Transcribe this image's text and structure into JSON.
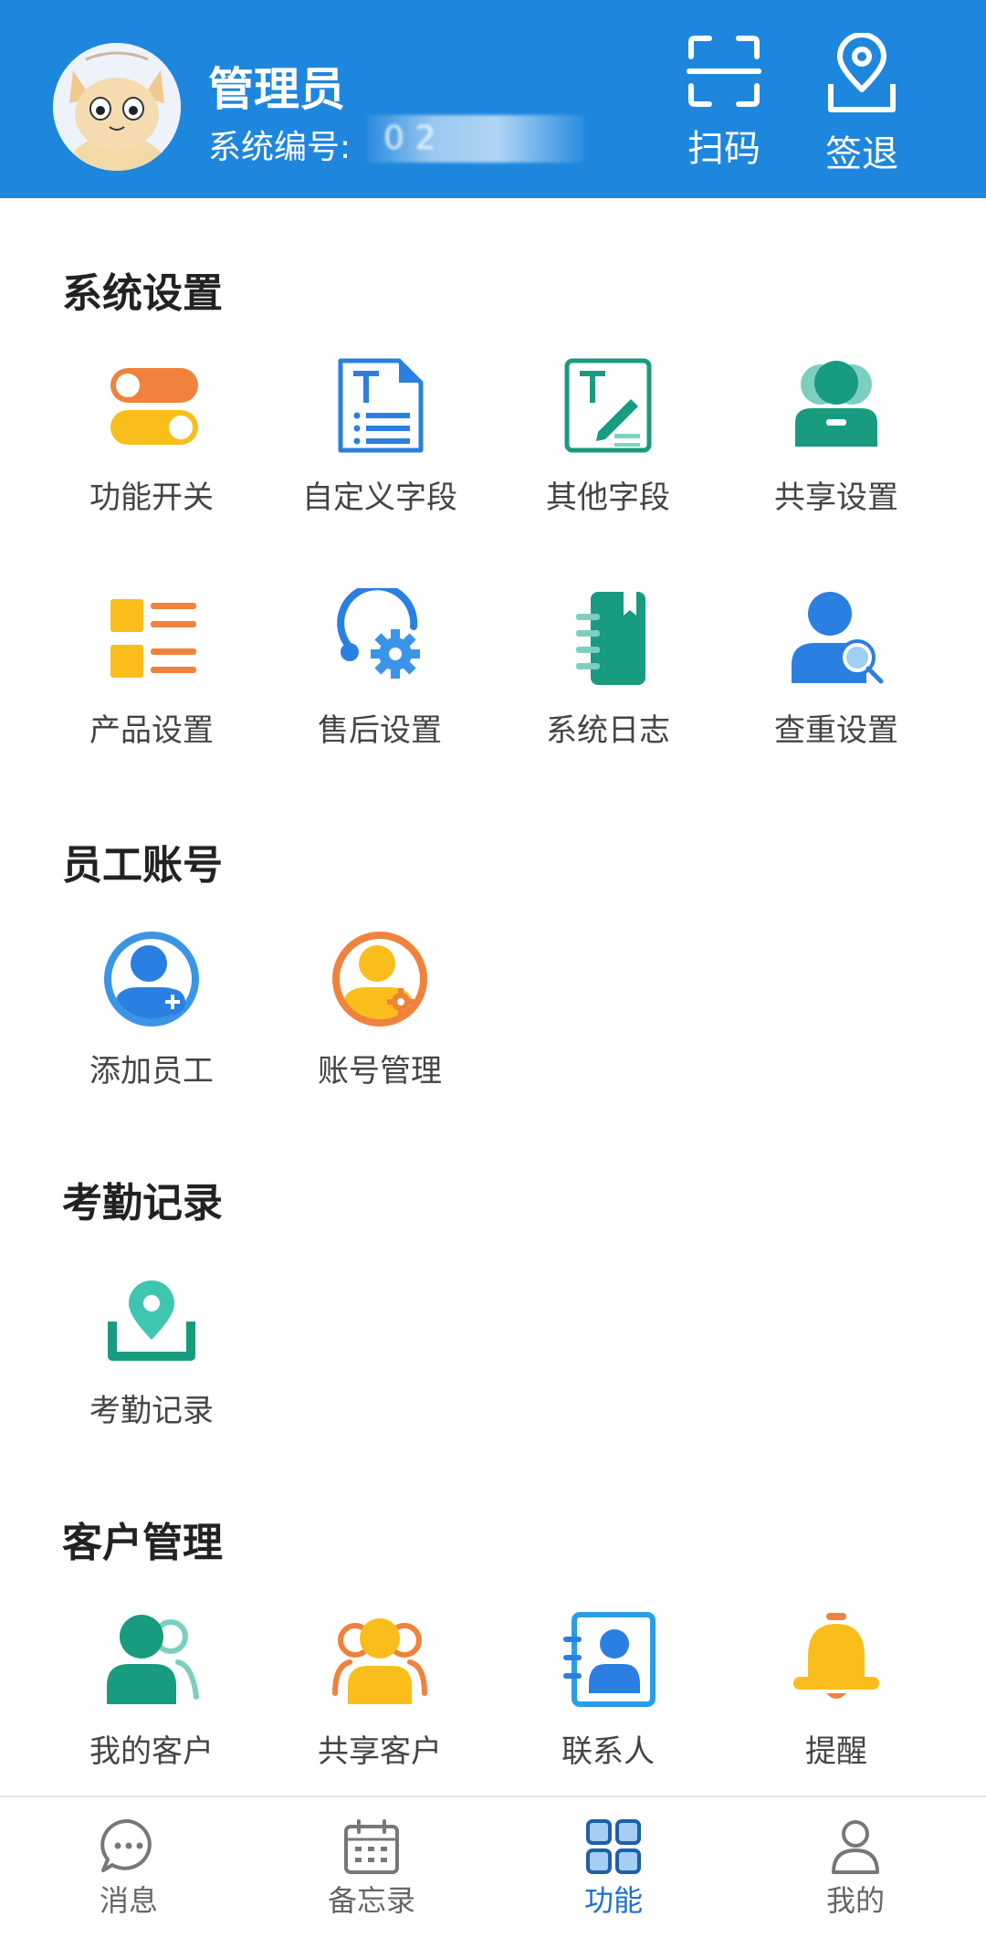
{
  "header": {
    "user_name": "管理员",
    "user_id_label": "系统编号:",
    "user_id_value": "0            2",
    "scan_label": "扫码",
    "checkout_label": "签退",
    "bg_color": "#1f86de"
  },
  "sections": {
    "system": {
      "title": "系统设置",
      "items": [
        {
          "label": "功能开关",
          "icon": "toggle-switches-icon"
        },
        {
          "label": "自定义字段",
          "icon": "custom-field-document-icon"
        },
        {
          "label": "其他字段",
          "icon": "edit-field-icon"
        },
        {
          "label": "共享设置",
          "icon": "shared-users-icon"
        },
        {
          "label": "产品设置",
          "icon": "product-list-icon"
        },
        {
          "label": "售后设置",
          "icon": "service-gear-icon"
        },
        {
          "label": "系统日志",
          "icon": "notebook-icon"
        },
        {
          "label": "查重设置",
          "icon": "user-search-icon"
        }
      ]
    },
    "staff": {
      "title": "员工账号",
      "items": [
        {
          "label": "添加员工",
          "icon": "add-user-icon"
        },
        {
          "label": "账号管理",
          "icon": "user-settings-icon"
        }
      ]
    },
    "attendance": {
      "title": "考勤记录",
      "items": [
        {
          "label": "考勤记录",
          "icon": "location-pin-icon"
        }
      ]
    },
    "customers": {
      "title": "客户管理",
      "items": [
        {
          "label": "我的客户",
          "icon": "my-customers-icon"
        },
        {
          "label": "共享客户",
          "icon": "shared-customers-icon"
        },
        {
          "label": "联系人",
          "icon": "contact-card-icon"
        },
        {
          "label": "提醒",
          "icon": "bell-icon"
        }
      ]
    }
  },
  "tabbar": {
    "active_color": "#1f6fcf",
    "tabs": [
      {
        "label": "消息",
        "icon": "chat-bubble-icon",
        "active": false
      },
      {
        "label": "备忘录",
        "icon": "calendar-icon",
        "active": false
      },
      {
        "label": "功能",
        "icon": "grid-icon",
        "active": true
      },
      {
        "label": "我的",
        "icon": "person-icon",
        "active": false
      }
    ]
  }
}
